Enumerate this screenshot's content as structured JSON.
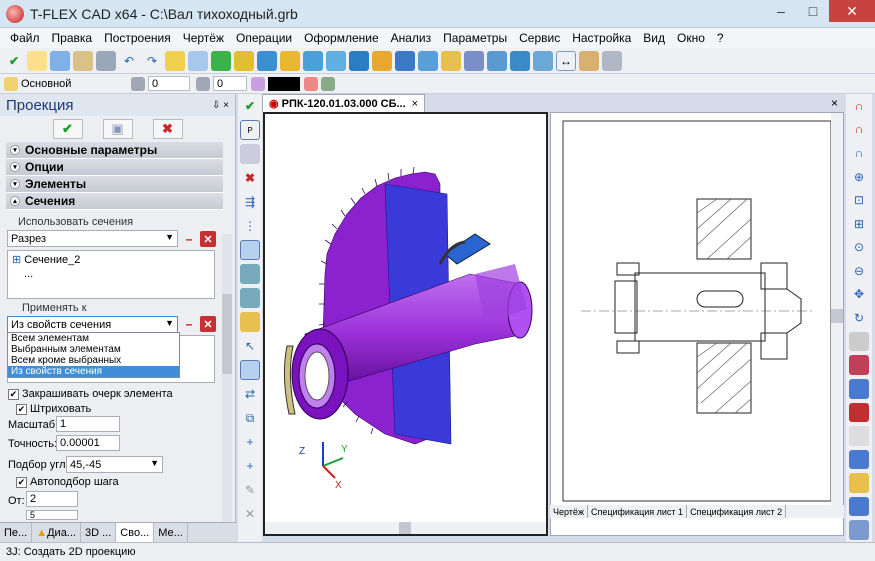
{
  "window": {
    "title": "T-FLEX CAD x64 - C:\\Вал тихоходный.grb",
    "minimize": "–",
    "maximize": "□",
    "close": "✕"
  },
  "menu": [
    "Файл",
    "Правка",
    "Построения",
    "Чертёж",
    "Операции",
    "Оформление",
    "Анализ",
    "Параметры",
    "Сервис",
    "Настройка",
    "Вид",
    "Окно",
    "?"
  ],
  "toolbar2": {
    "layer": "Основной",
    "value1": "0",
    "value2": "0"
  },
  "panel": {
    "title": "Проекция",
    "pin": "⇩ ×",
    "sections": {
      "basic": "Основные параметры",
      "options": "Опции",
      "elements": "Элементы",
      "cuts": "Сечения"
    },
    "use_cuts_label": "Использовать сечения",
    "cut_type": "Разрез",
    "cut_tree": [
      "Сечение_2",
      "..."
    ],
    "apply_to_label": "Применять к",
    "apply_to_value": "Из свойств сечения",
    "dropdown_options": [
      "Всем элементам",
      "Выбранным элементам",
      "Всем кроме выбранных",
      "Из свойств сечения"
    ],
    "fill_outline": "Закрашивать очерк элемента",
    "hatch": "Штриховать",
    "scale_label": "Масштаб:",
    "scale_value": "1",
    "accuracy_label": "Точность:",
    "accuracy_value": "0.00001",
    "angle_label": "Подбор угла:",
    "angle_value": "45,-45",
    "auto_step": "Автоподбор шага",
    "from_label": "От:",
    "from_value": "2",
    "to_value": "5",
    "tabs": [
      "Пе...",
      "Диа...",
      "3D ...",
      "Сво...",
      "Ме..."
    ]
  },
  "document": {
    "tab_label": "РПК-120.01.03.000 СБ...",
    "sheet_tabs": [
      "Чертёж",
      "Спецификация лист 1",
      "Спецификация лист 2"
    ]
  },
  "axes": {
    "x": "X",
    "y": "Y",
    "z": "Z"
  },
  "status": "3J: Создать 2D проекцию"
}
